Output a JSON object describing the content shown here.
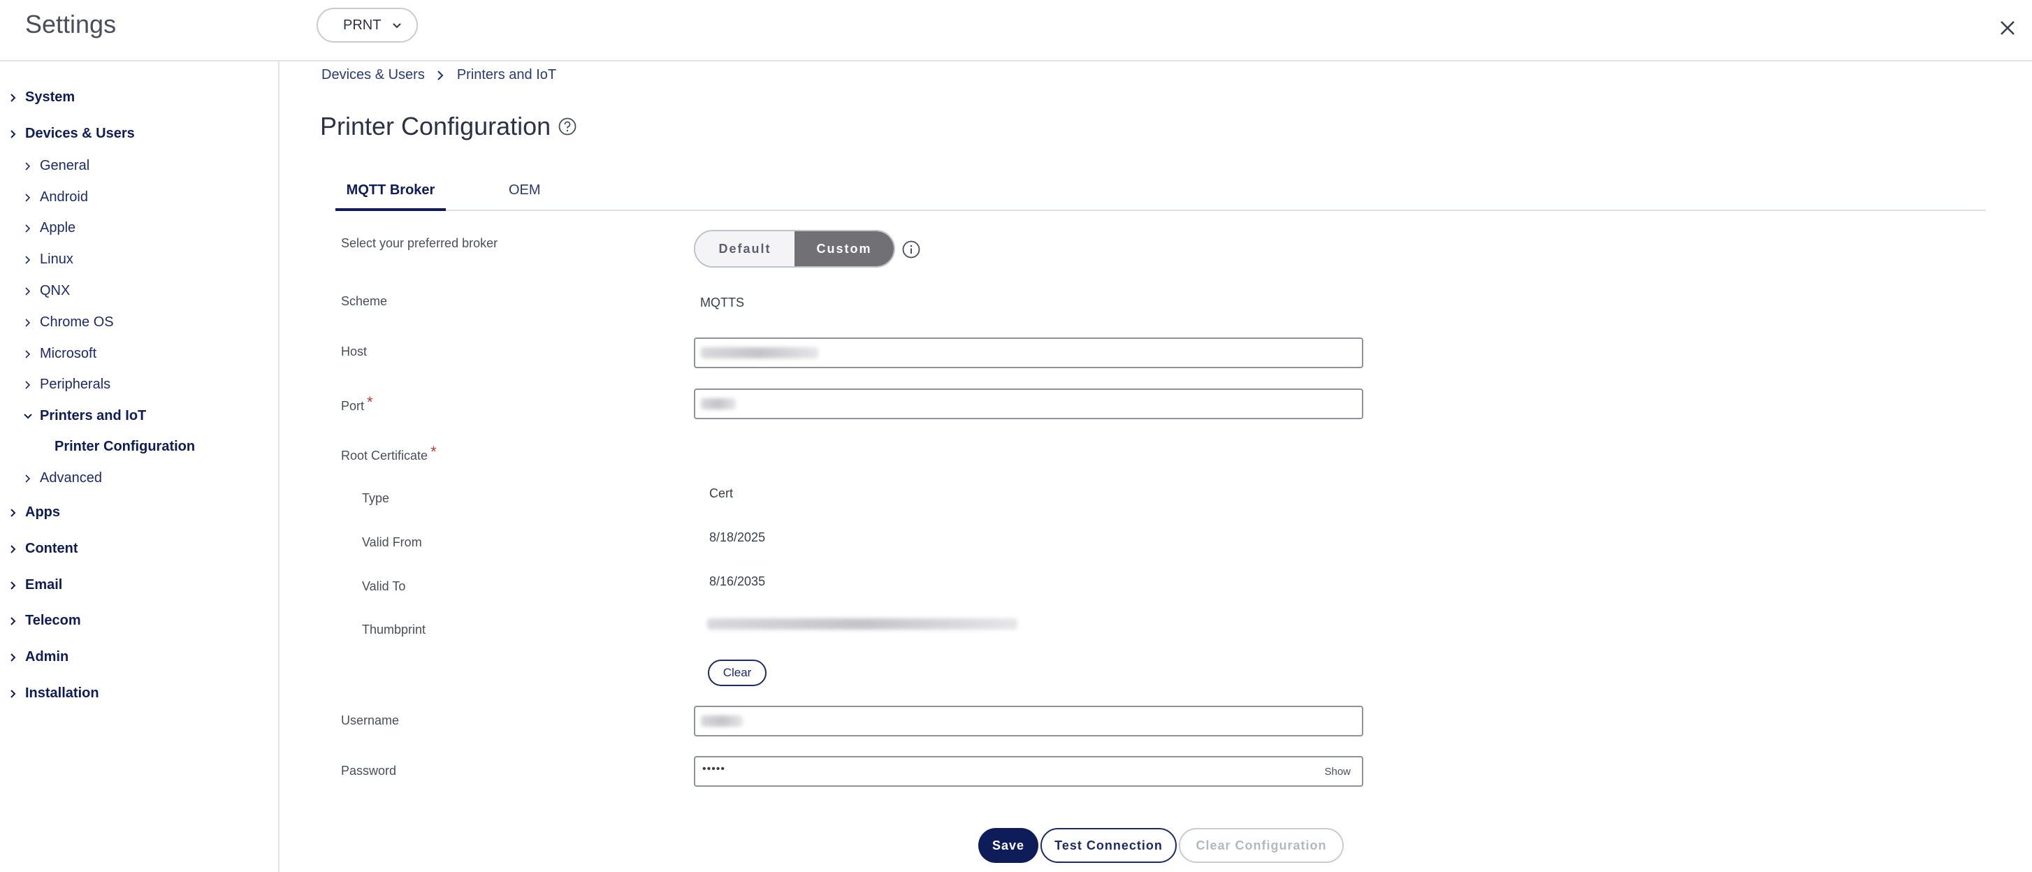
{
  "header": {
    "title": "Settings",
    "org_selector": "PRNT"
  },
  "sidebar": {
    "items": [
      {
        "label": "System"
      },
      {
        "label": "Devices & Users"
      },
      {
        "label": "General"
      },
      {
        "label": "Android"
      },
      {
        "label": "Apple"
      },
      {
        "label": "Linux"
      },
      {
        "label": "QNX"
      },
      {
        "label": "Chrome OS"
      },
      {
        "label": "Microsoft"
      },
      {
        "label": "Peripherals"
      },
      {
        "label": "Printers and IoT"
      },
      {
        "label": "Printer Configuration"
      },
      {
        "label": "Advanced"
      },
      {
        "label": "Apps"
      },
      {
        "label": "Content"
      },
      {
        "label": "Email"
      },
      {
        "label": "Telecom"
      },
      {
        "label": "Admin"
      },
      {
        "label": "Installation"
      }
    ]
  },
  "breadcrumb": [
    "Devices & Users",
    "Printers and IoT"
  ],
  "page": {
    "title": "Printer Configuration"
  },
  "tabs": [
    {
      "label": "MQTT Broker",
      "active": true
    },
    {
      "label": "OEM",
      "active": false
    }
  ],
  "form": {
    "broker_label": "Select your preferred broker",
    "broker_options": [
      "Default",
      "Custom"
    ],
    "broker_selected": "Custom",
    "scheme_label": "Scheme",
    "scheme_value": "MQTTS",
    "host_label": "Host",
    "port_label": "Port",
    "root_cert_label": "Root Certificate",
    "type_label": "Type",
    "type_value": "Cert",
    "valid_from_label": "Valid From",
    "valid_from_value": "8/18/2025",
    "valid_to_label": "Valid To",
    "valid_to_value": "8/16/2035",
    "thumbprint_label": "Thumbprint",
    "clear_label": "Clear",
    "username_label": "Username",
    "password_label": "Password",
    "password_value": "•••••",
    "show_label": "Show"
  },
  "actions": {
    "save": "Save",
    "test_connection": "Test Connection",
    "clear_configuration": "Clear Configuration"
  },
  "colors": {
    "brand_navy": "#0f1c5a",
    "toggle_active": "#707075",
    "required": "#d0342c"
  }
}
